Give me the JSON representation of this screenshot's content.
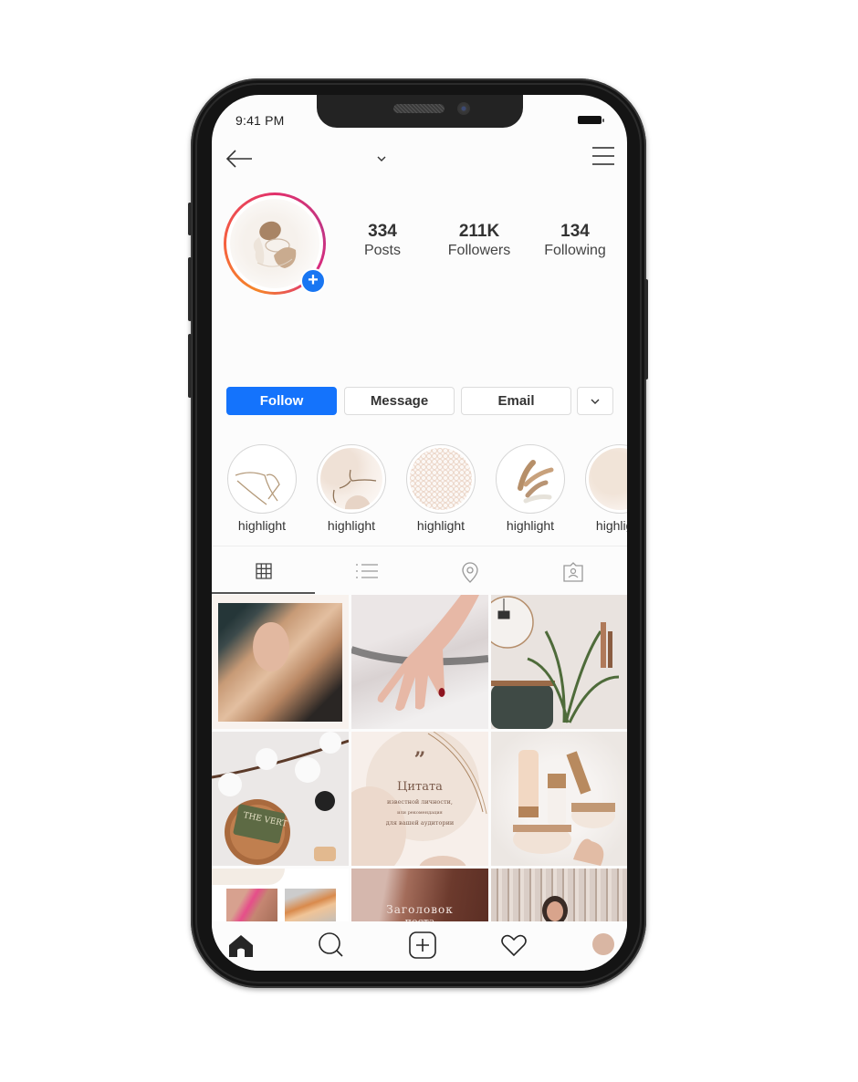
{
  "status_bar": {
    "time": "9:41 PM",
    "battery_icon": "battery-full-icon"
  },
  "header": {
    "back_icon": "arrow-left-icon",
    "username_dropdown_icon": "chevron-down-icon",
    "menu_icon": "hamburger-menu-icon"
  },
  "profile": {
    "avatar_icon": "profile-avatar",
    "add_story_label": "+",
    "stats": [
      {
        "value": "334",
        "label": "Posts"
      },
      {
        "value": "211K",
        "label": "Followers"
      },
      {
        "value": "134",
        "label": "Following"
      }
    ]
  },
  "actions": {
    "follow": "Follow",
    "message": "Message",
    "email": "Email",
    "more_icon": "chevron-down-icon"
  },
  "highlights": [
    {
      "label": "highlight"
    },
    {
      "label": "highlight"
    },
    {
      "label": "highlight"
    },
    {
      "label": "highlight"
    },
    {
      "label": "highlight"
    }
  ],
  "tabs": [
    {
      "name": "grid",
      "icon": "grid-icon",
      "active": true
    },
    {
      "name": "list",
      "icon": "list-icon",
      "active": false
    },
    {
      "name": "location",
      "icon": "location-pin-icon",
      "active": false
    },
    {
      "name": "tagged",
      "icon": "tagged-person-icon",
      "active": false
    }
  ],
  "posts": [
    {
      "description": "woman with long blonde hair portrait"
    },
    {
      "description": "hand with one red painted nail"
    },
    {
      "description": "interior with plant, mirror and leather sofa"
    },
    {
      "description": "cotton branch and soap on wooden dish",
      "text": "THE VERT"
    },
    {
      "description": "quote template",
      "quote_mark": "”",
      "title": "Цитата",
      "line1": "известной личности,",
      "line2": "или рекомендация",
      "line3": "для вашей аудитории"
    },
    {
      "description": "skincare products on fur"
    },
    {
      "description": "makeup eye collage"
    },
    {
      "description": "hand in hair post title",
      "title": "Заголовок",
      "subtitle": "поста"
    },
    {
      "description": "woman with sunglasses near curtains"
    }
  ],
  "colors": {
    "accent_blue": "#1473fc",
    "story_ring_start": "#f58529",
    "story_ring_end": "#dd2a7b",
    "profile_avatar_nav": "#d9b6a3"
  },
  "bottom_nav": [
    {
      "name": "home",
      "icon": "home-icon"
    },
    {
      "name": "search",
      "icon": "search-icon"
    },
    {
      "name": "new-post",
      "icon": "add-post-icon"
    },
    {
      "name": "activity",
      "icon": "heart-icon"
    },
    {
      "name": "profile",
      "icon": "profile-avatar-icon"
    }
  ]
}
